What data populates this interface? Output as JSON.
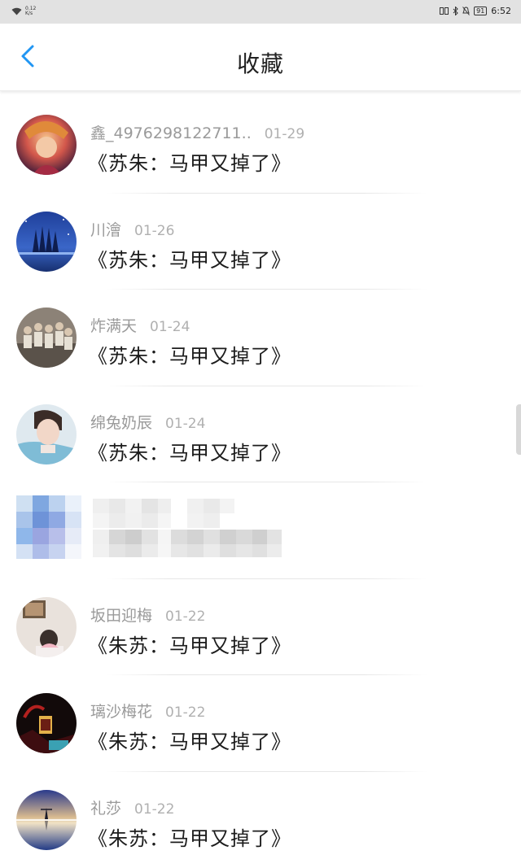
{
  "status_bar": {
    "net_speed_value": "0.12",
    "net_speed_unit": "K/s",
    "battery": "91",
    "time": "6:52"
  },
  "header": {
    "title": "收藏",
    "back_icon": "chevron-left-icon"
  },
  "colors": {
    "accent": "#2196f3",
    "status_bar_bg": "#e2e2e2"
  },
  "favorites": [
    {
      "user": "鑫_4976298122711..",
      "date": "01-29",
      "title": "《苏朱：马甲又掉了》"
    },
    {
      "user": "川澮",
      "date": "01-26",
      "title": "《苏朱：马甲又掉了》"
    },
    {
      "user": "炸满天",
      "date": "01-24",
      "title": "《苏朱：马甲又掉了》"
    },
    {
      "user": "绵兔奶辰",
      "date": "01-24",
      "title": "《苏朱：马甲又掉了》"
    },
    {
      "user": "",
      "date": "",
      "title": ""
    },
    {
      "user": "坂田迎梅",
      "date": "01-22",
      "title": "《朱苏：马甲又掉了》"
    },
    {
      "user": "璃沙梅花",
      "date": "01-22",
      "title": "《朱苏：马甲又掉了》"
    },
    {
      "user": "礼莎",
      "date": "01-22",
      "title": "《朱苏：马甲又掉了》"
    }
  ]
}
